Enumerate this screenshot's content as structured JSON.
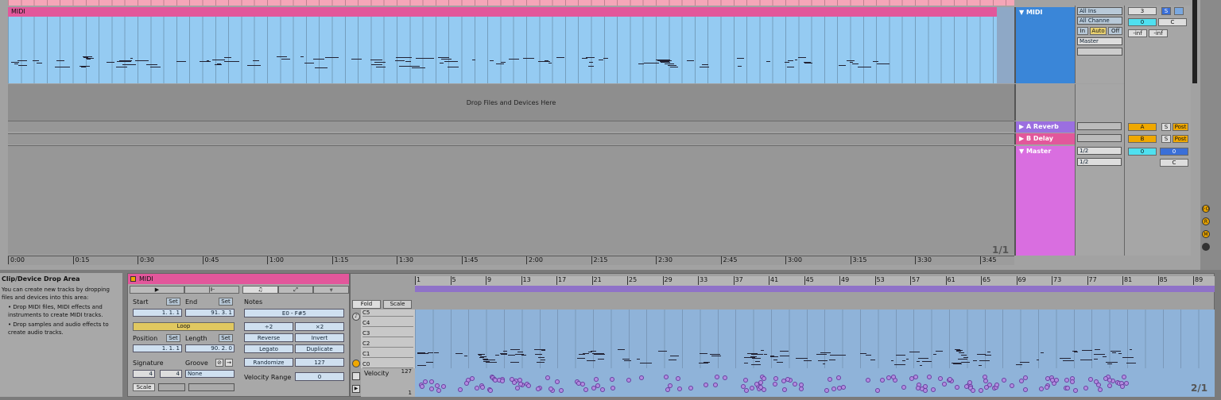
{
  "arrangement": {
    "clip_name": "MIDI",
    "drop_text": "Drop Files and Devices Here",
    "page_indicator": "1/1",
    "time_ticks": [
      "0:00",
      "0:15",
      "0:30",
      "0:45",
      "1:00",
      "1:15",
      "1:30",
      "1:45",
      "2:00",
      "2:15",
      "2:30",
      "2:45",
      "3:00",
      "3:15",
      "3:30",
      "3:45"
    ]
  },
  "tracks": {
    "midi": {
      "name": "MIDI",
      "input": "All Ins",
      "channel": "All Channe",
      "monitor": [
        "In",
        "Auto",
        "Off"
      ],
      "output": "Master",
      "track_num": "3",
      "solo": "S",
      "vol": "0",
      "pan": "C",
      "peak1": "-inf",
      "peak2": "-inf",
      "color": "#3a86d8"
    },
    "reverb": {
      "name": "A Reverb",
      "send": "A",
      "solo": "S",
      "post": "Post",
      "color": "#9b6fe0"
    },
    "delay": {
      "name": "B Delay",
      "send": "B",
      "solo": "S",
      "post": "Post",
      "color": "#e2579b"
    },
    "master": {
      "name": "Master",
      "out1": "1/2",
      "out2": "1/2",
      "vol": "0",
      "vol2": "0",
      "pan": "C",
      "color": "#d96ee0"
    }
  },
  "info": {
    "title": "Clip/Device Drop Area",
    "body": "You can create new tracks by dropping files and devices into this area:",
    "bullet1": "Drop MIDI files, MIDI effects and instruments to create MIDI tracks.",
    "bullet2": "Drop samples and audio effects to create audio tracks."
  },
  "clip": {
    "name": "MIDI",
    "start_label": "Start",
    "end_label": "End",
    "set": "Set",
    "start": "1.   1.   1",
    "end": "91.   3.   1",
    "loop": "Loop",
    "position_label": "Position",
    "length_label": "Length",
    "position": "1.   1.   1",
    "length": "90.   2.   0",
    "signature_label": "Signature",
    "groove_label": "Groove",
    "sig_num": "4",
    "sig_den": "4",
    "groove": "None",
    "scale": "Scale",
    "notes_label": "Notes",
    "range": "E0 - F#5",
    "div2": "÷2",
    "mul2": "×2",
    "reverse": "Reverse",
    "invert": "Invert",
    "legato": "Legato",
    "duplicate": "Duplicate",
    "randomize": "Randomize",
    "rand_val": "127",
    "vel_range_label": "Velocity Range",
    "vel_range": "0"
  },
  "editor": {
    "fold": "Fold",
    "scale": "Scale",
    "keys": [
      "C5",
      "C4",
      "C3",
      "C2",
      "C1",
      "C0"
    ],
    "velocity": "Velocity",
    "vel_max": "127",
    "vel_min": "1",
    "bars": [
      "1",
      "5",
      "9",
      "13",
      "17",
      "21",
      "25",
      "29",
      "33",
      "37",
      "41",
      "45",
      "49",
      "53",
      "57",
      "61",
      "65",
      "69",
      "73",
      "77",
      "81",
      "85",
      "89"
    ],
    "page": "2/1"
  }
}
